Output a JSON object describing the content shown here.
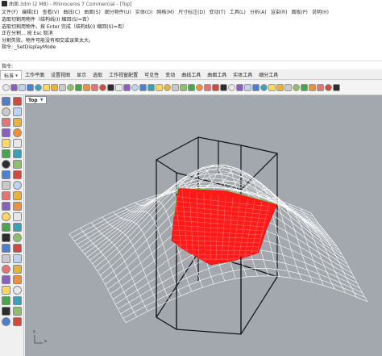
{
  "window": {
    "title": "曲面.3dm (2 MB) - Rhinoceros 7 Commercial - [Top]"
  },
  "menubar": {
    "items": [
      "文件(F)",
      "编辑(E)",
      "查看(V)",
      "曲线(C)",
      "曲面(S)",
      "细分物件(U)",
      "实体(O)",
      "网格(M)",
      "尺寸标注(D)",
      "变动(T)",
      "工具(L)",
      "分析(A)",
      "渲染(R)",
      "面板(P)",
      "说明(H)"
    ]
  },
  "command_history": {
    "lines": [
      "选取切割用物件（结构线(I) 缩回(S)=否）",
      "选取切割用物件。按 Enter 完成（结构线(I) 缩回(S)=否）",
      "正在分割... 按 Esc 取消",
      "分割失败。物件可能没有相交或误差太大。",
      "指令: _SetDisplayMode"
    ],
    "prompt": "指令:"
  },
  "tabs": {
    "items": [
      "标准",
      "工作平面",
      "设置视图",
      "显示",
      "选取",
      "工作视窗配置",
      "可见性",
      "变动",
      "曲线工具",
      "曲面工具",
      "实体工具",
      "细分工具"
    ],
    "active_index": 0
  },
  "viewport": {
    "label": "Top",
    "axis_x": "x",
    "axis_y": "y",
    "background_color": "#a3a8ae",
    "surface_color": "#ff1a1a",
    "wire_color": "#ffffff",
    "box_color": "#111111"
  },
  "icons": {
    "toolbar": [
      "new-file-icon",
      "open-icon",
      "save-icon",
      "print-icon",
      "import-icon",
      "cut-icon",
      "copy-icon",
      "paste-icon",
      "undo-icon",
      "redo-icon",
      "pan-icon",
      "rotate-icon",
      "zoom-icon",
      "zoom-window-icon",
      "zoom-extents-icon",
      "zoom-selected-icon",
      "grid-icon",
      "four-view-icon",
      "properties-icon",
      "layer-icon",
      "wireframe-icon",
      "shaded-icon",
      "rendered-icon",
      "ghosted-icon",
      "xray-icon",
      "point-icon",
      "curve-icon",
      "surface-icon",
      "solid-icon",
      "sphere-icon",
      "cylinder-icon",
      "torus-icon",
      "mesh-icon",
      "light-icon",
      "material-icon",
      "render-icon",
      "environment-icon",
      "snapshot-icon",
      "help-icon",
      "options-icon",
      "rgb-icon",
      "palette-icon"
    ],
    "left": [
      "select-icon",
      "point-icon",
      "polyline-icon",
      "curve-icon",
      "circle-icon",
      "arc-icon",
      "rectangle-icon",
      "polygon-icon",
      "ellipse-icon",
      "freeform-icon",
      "fillet-icon",
      "offset-icon",
      "surface-icon",
      "loft-icon",
      "sweep-icon",
      "extrude-icon",
      "box-icon",
      "sphere-icon",
      "cylinder-icon",
      "cone-icon",
      "boolean-union-icon",
      "boolean-diff-icon",
      "mesh-icon",
      "split-icon",
      "trim-icon",
      "join-icon",
      "explode-icon",
      "move-icon",
      "copy-icon",
      "rotate-icon",
      "scale-icon",
      "mirror-icon",
      "array-icon",
      "dimension-icon",
      "text-icon",
      "hatch-icon",
      "analyze-icon",
      "render-icon",
      "layer-icon",
      "properties-icon",
      "grid-icon",
      "snap-icon",
      "group-icon",
      "block-icon"
    ]
  }
}
